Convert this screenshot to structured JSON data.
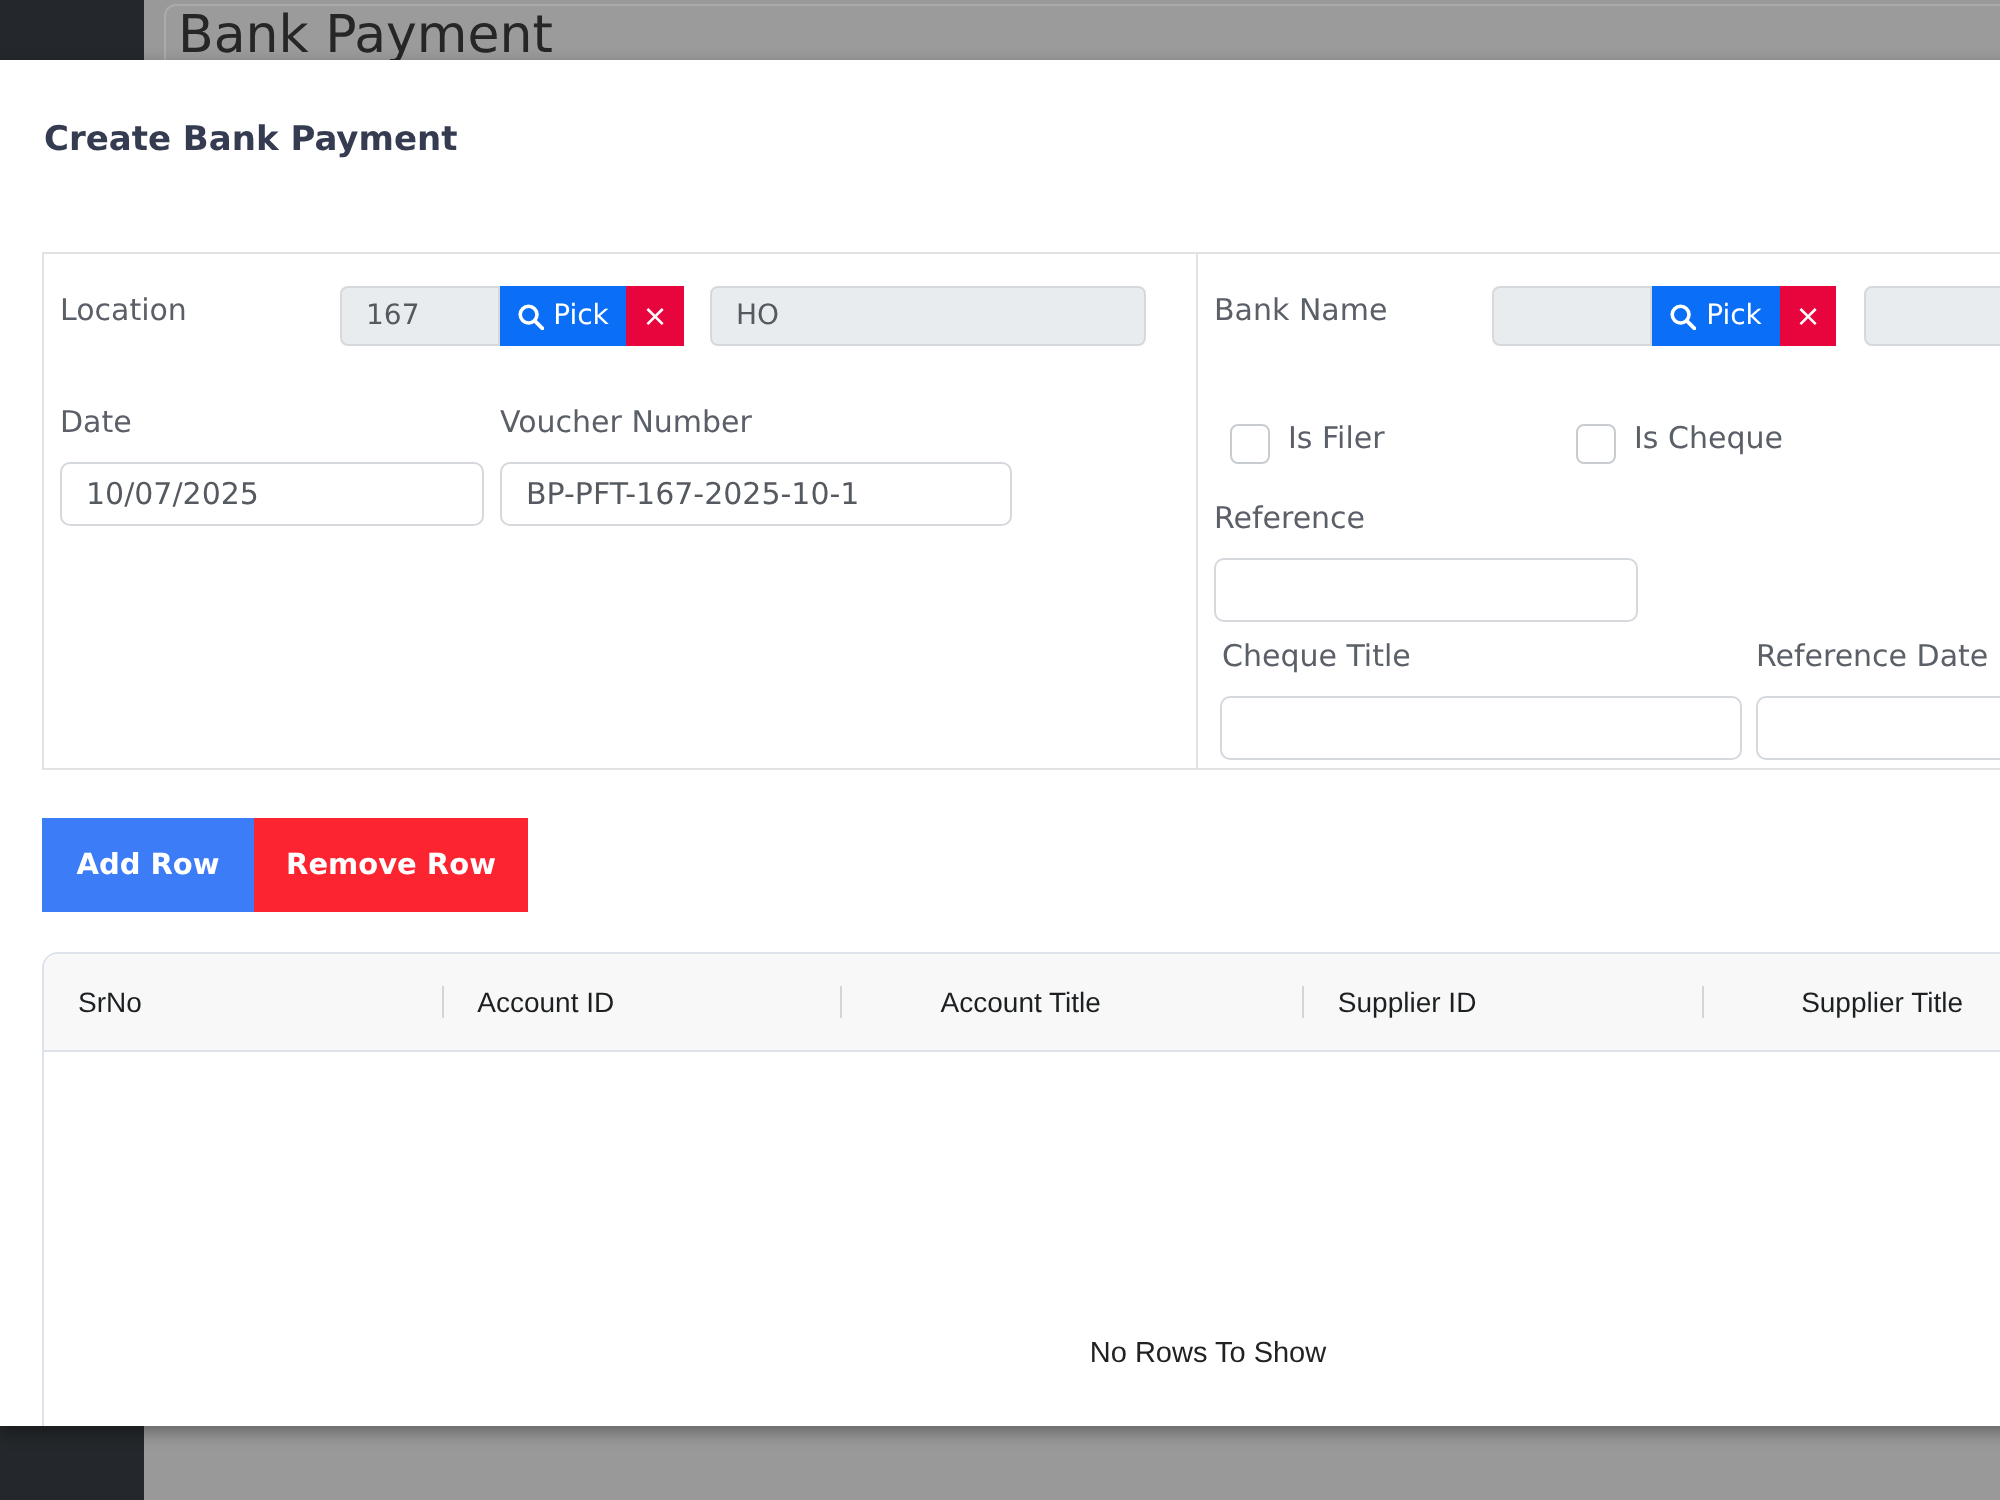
{
  "background": {
    "page_title": "Bank Payment"
  },
  "dialog": {
    "title": "Create Bank Payment"
  },
  "form": {
    "location": {
      "label": "Location",
      "code_field": {
        "value": "167",
        "disabled": true
      },
      "pick_button": "Pick",
      "clear_button": "×",
      "name_field": {
        "value": "HO",
        "disabled": true
      }
    },
    "date": {
      "label": "Date",
      "value": "10/07/2025"
    },
    "voucher_number": {
      "label": "Voucher Number",
      "value": "BP-PFT-167-2025-10-1"
    },
    "bank_name": {
      "label": "Bank Name",
      "code_field": {
        "disabled": true
      },
      "pick_button": "Pick",
      "clear_button": "×",
      "name_field": {
        "disabled": true
      }
    },
    "checkboxes": [
      {
        "label": "Is Filer",
        "checked": false
      },
      {
        "label": "Is Cheque",
        "checked": false
      }
    ],
    "reference": {
      "label": "Reference"
    },
    "cheque_title": {
      "label": "Cheque Title"
    },
    "reference_date": {
      "label": "Reference Date"
    }
  },
  "row_buttons": [
    {
      "label": "Add Row",
      "kind": "add"
    },
    {
      "label": "Remove Row",
      "kind": "remove"
    }
  ],
  "table": {
    "columns": [
      "SrNo",
      "Account ID",
      "Account Title",
      "Supplier ID",
      "Supplier Title"
    ],
    "empty_message": "No Rows To Show"
  }
}
